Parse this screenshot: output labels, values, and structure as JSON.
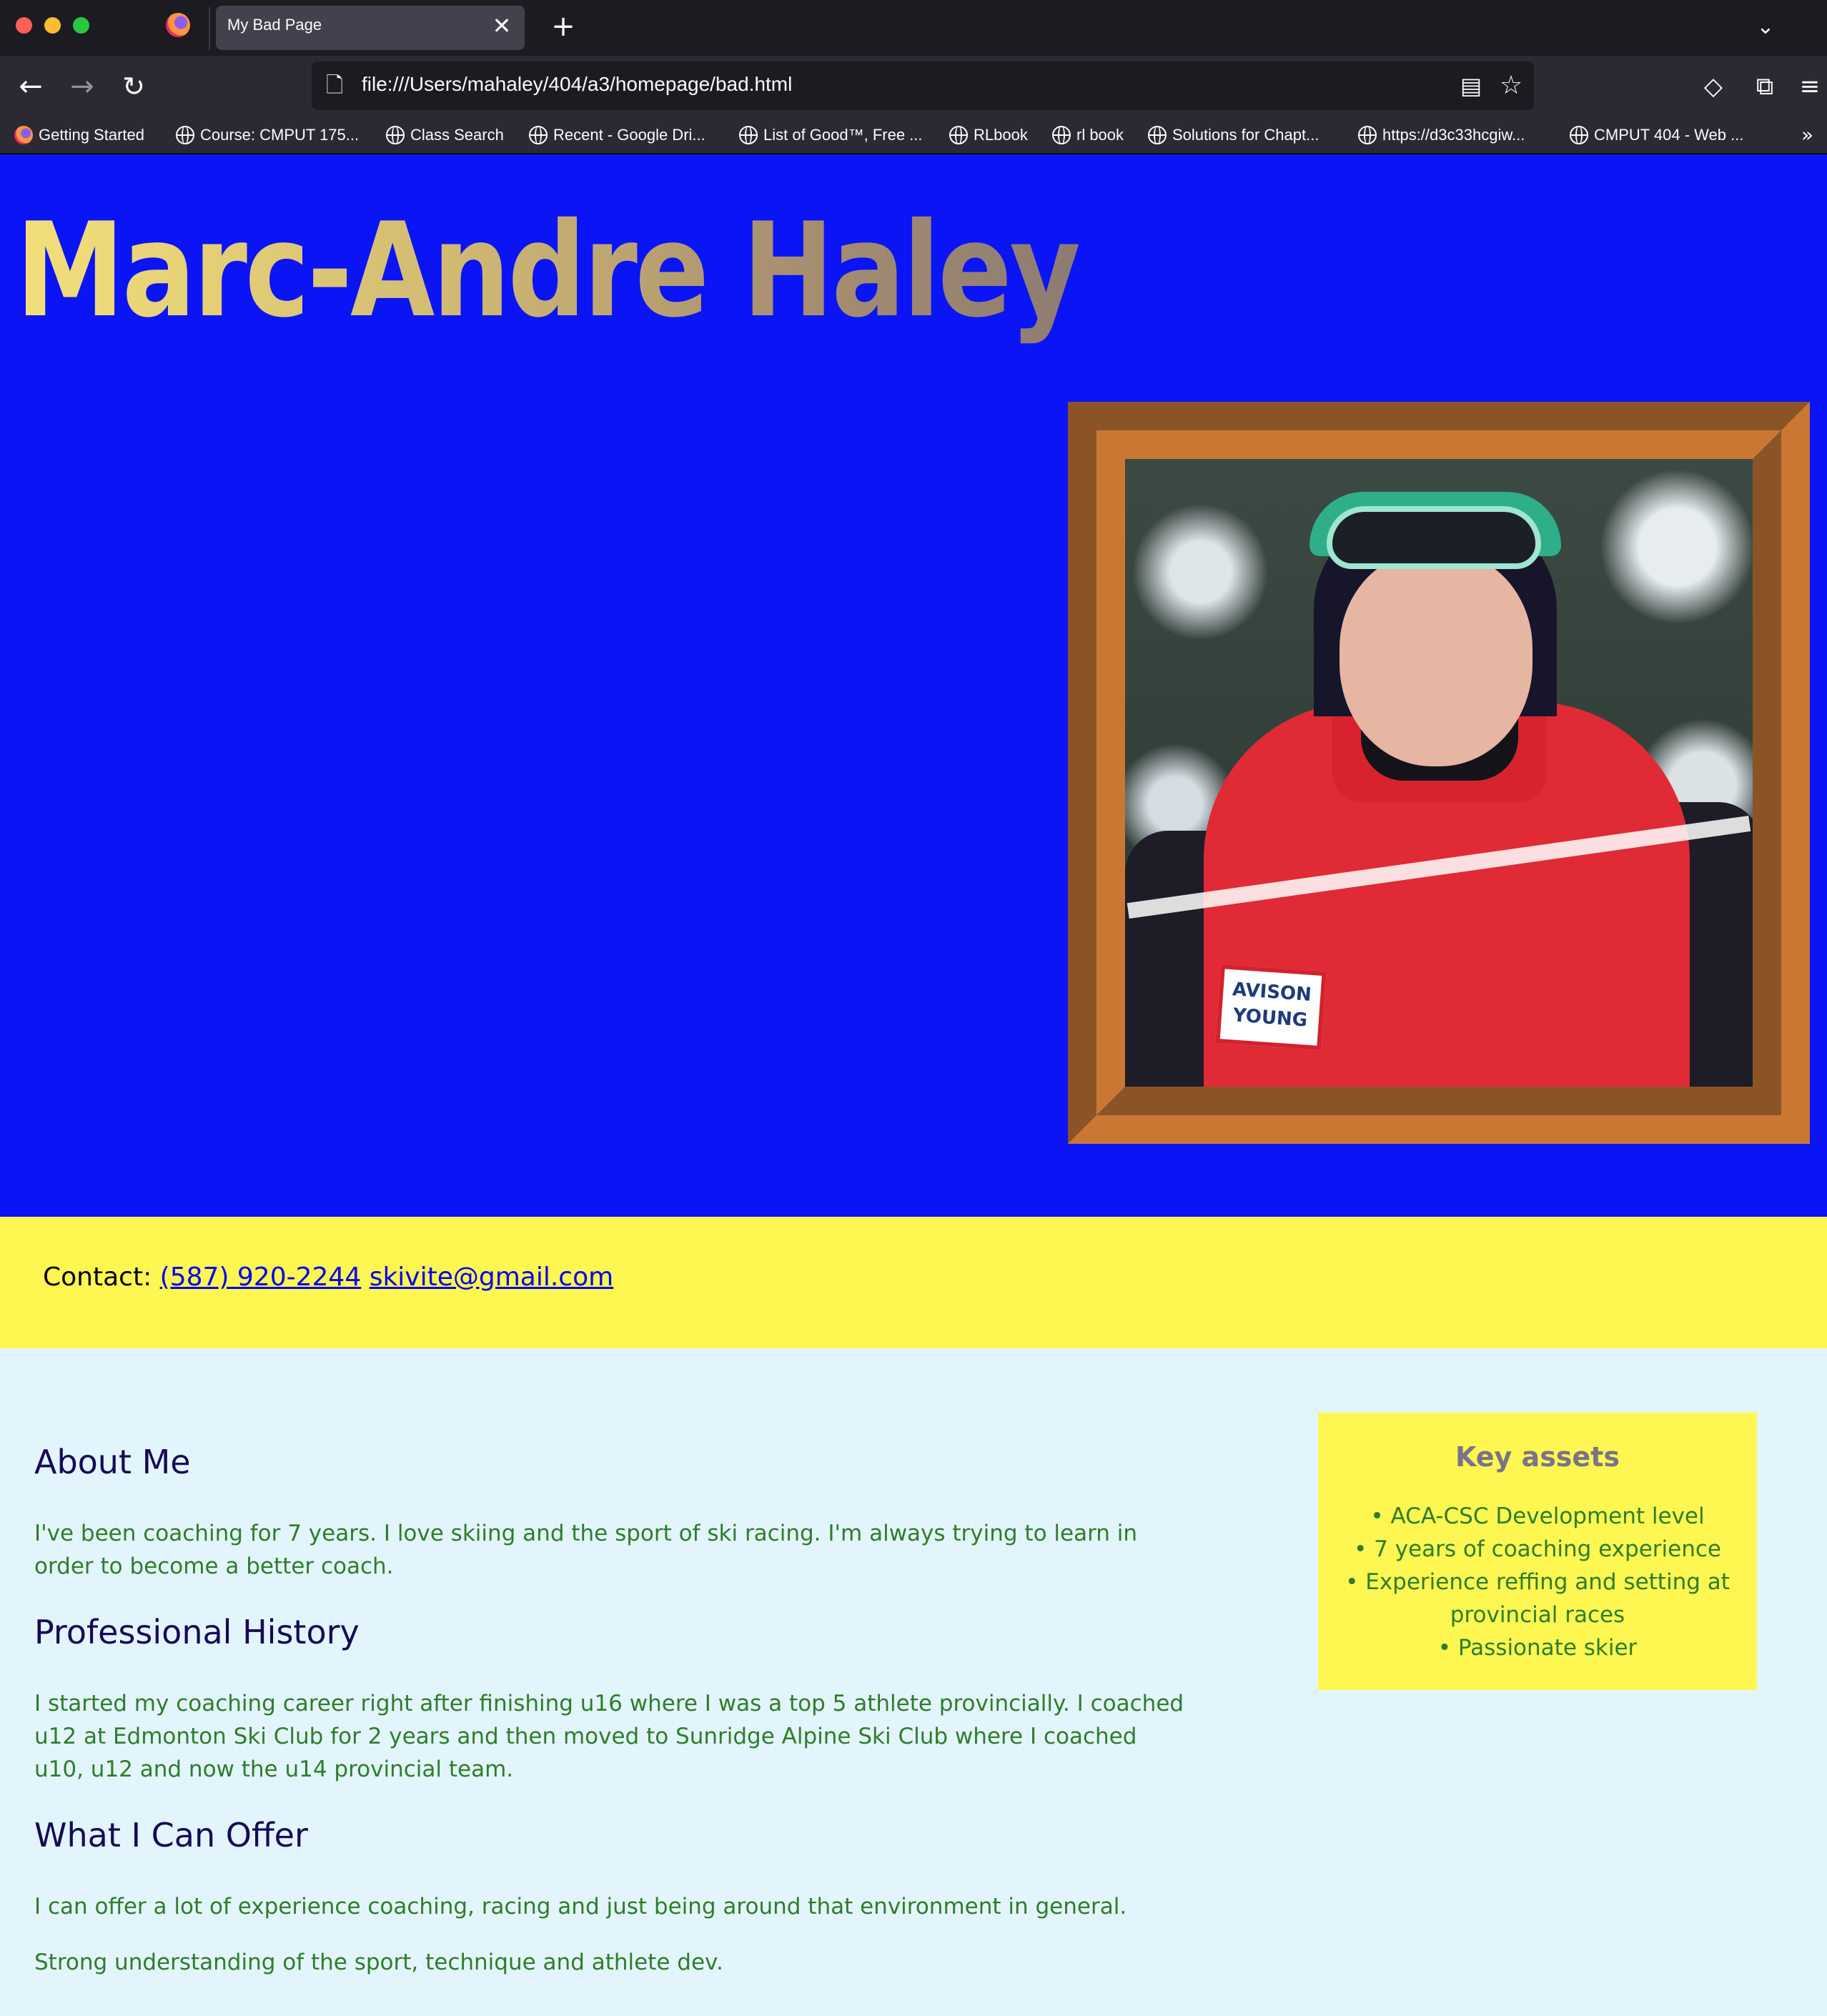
{
  "browser": {
    "tab_title": "My Bad Page",
    "tab_close": "✕",
    "new_tab": "+",
    "tab_list": "⌄",
    "url": "file:///Users/mahaley/404/a3/homepage/bad.html",
    "icons": {
      "back": "←",
      "forward": "→",
      "reload": "↻",
      "page": "🗋",
      "reader": "▤",
      "star": "☆",
      "pocket": "◇",
      "extensions": "⧉",
      "menu": "≡"
    },
    "bookmarks": [
      "Getting Started",
      "Course: CMPUT 175...",
      "Class Search",
      "Recent - Google Dri...",
      "List of Good™, Free ...",
      "RLbook",
      "rl book",
      "Solutions for Chapt...",
      "https://d3c33hcgiw...",
      "CMPUT 404 - Web ..."
    ],
    "bookmarks_overflow": "»"
  },
  "page": {
    "name": "Marc-Andre Haley",
    "photo_badge": "AVISON YOUNG",
    "contact": {
      "label": "Contact:",
      "phone": "(587) 920-2244",
      "email": "skivite@gmail.com"
    },
    "about": {
      "heading": "About Me",
      "text": "I've been coaching for 7 years. I love skiing and the sport of ski racing. I'm always trying to learn in order to become a better coach."
    },
    "history": {
      "heading": "Professional History",
      "text": "I started my coaching career right after finishing u16 where I was a top 5 athlete provincially. I coached u12 at Edmonton Ski Club for 2 years and then moved to Sunridge Alpine Ski Club where I coached u10, u12 and now the u14 provincial team."
    },
    "offer": {
      "heading": "What I Can Offer",
      "text1": "I can offer a lot of experience coaching, racing and just being around that environment in general.",
      "text2": "Strong understanding of the sport, technique and athlete dev."
    },
    "assets": {
      "title": "Key assets",
      "items": [
        "ACA-CSC Development level",
        "7 years of coaching experience",
        "Experience reffing and setting at provincial races",
        "Passionate skier"
      ]
    }
  },
  "colors": {
    "hero_bg": "#0a14f5",
    "contact_bg": "#fef751",
    "main_bg": "#e3f5fc",
    "heading": "#150a57",
    "text": "#2e7d2b",
    "link": "#0000ee",
    "frame_dark": "#8b5426",
    "frame_light": "#cb7734"
  }
}
